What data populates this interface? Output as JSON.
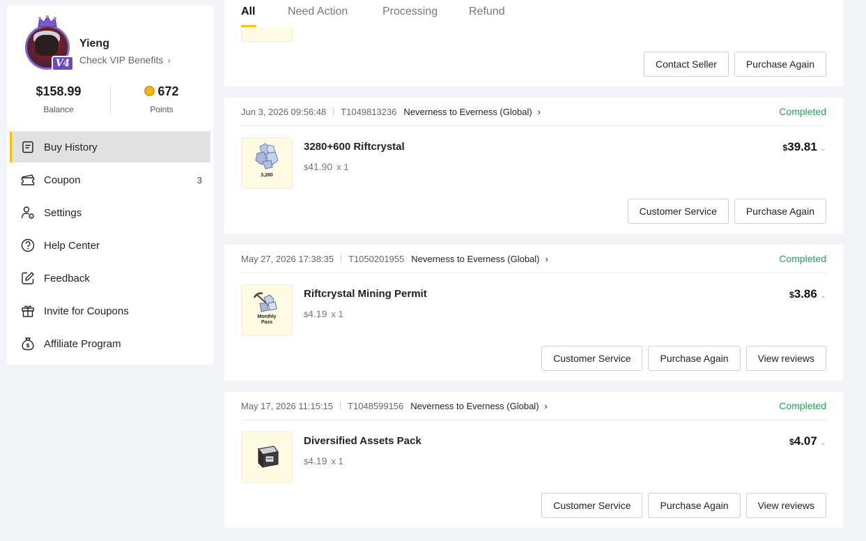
{
  "profile": {
    "username": "Yieng",
    "vip_link": "Check VIP Benefits",
    "vip_level": "V4"
  },
  "stats": {
    "balance_value": "$158.99",
    "balance_label": "Balance",
    "points_value": "672",
    "points_label": "Points"
  },
  "menu": [
    {
      "label": "Buy History",
      "icon": "receipt-icon",
      "active": true
    },
    {
      "label": "Coupon",
      "icon": "ticket-icon",
      "count": "3"
    },
    {
      "label": "Settings",
      "icon": "user-settings-icon"
    },
    {
      "label": "Help Center",
      "icon": "help-icon"
    },
    {
      "label": "Feedback",
      "icon": "edit-icon"
    },
    {
      "label": "Invite for Coupons",
      "icon": "gift-icon"
    },
    {
      "label": "Affiliate Program",
      "icon": "money-bag-icon"
    }
  ],
  "tabs": [
    {
      "label": "All",
      "active": true
    },
    {
      "label": "Need Action"
    },
    {
      "label": "Processing"
    },
    {
      "label": "Refund"
    }
  ],
  "top_card": {
    "buttons": [
      "Contact Seller",
      "Purchase Again"
    ]
  },
  "orders": [
    {
      "date": "Jun 3, 2026 09:56:48",
      "order_id": "T1049813236",
      "game": "Neverness to Everness (Global)",
      "status": "Completed",
      "product_name": "3280+600 Riftcrystal",
      "thumb_label": "3,280",
      "unit_currency": "$",
      "unit_price": "41.90",
      "quantity": "x 1",
      "total_currency": "$",
      "total": "39.81",
      "buttons": [
        "Customer Service",
        "Purchase Again"
      ]
    },
    {
      "date": "May 27, 2026 17:38:35",
      "order_id": "T1050201955",
      "game": "Neverness to Everness (Global)",
      "status": "Completed",
      "product_name": "Riftcrystal Mining Permit",
      "thumb_label": "Monthly Pass",
      "unit_currency": "$",
      "unit_price": "4.19",
      "quantity": "x 1",
      "total_currency": "$",
      "total": "3.86",
      "buttons": [
        "Customer Service",
        "Purchase Again",
        "View reviews"
      ]
    },
    {
      "date": "May 17, 2026 11:15:15",
      "order_id": "T1048599156",
      "game": "Neverness to Everness (Global)",
      "status": "Completed",
      "product_name": "Diversified Assets Pack",
      "thumb_label": "",
      "unit_currency": "$",
      "unit_price": "4.19",
      "quantity": "x 1",
      "total_currency": "$",
      "total": "4.07",
      "buttons": [
        "Customer Service",
        "Purchase Again",
        "View reviews"
      ]
    }
  ],
  "colors": {
    "accent": "#f5c400",
    "status_completed": "#1fa755",
    "thumb_bg": "#fffbe1"
  }
}
